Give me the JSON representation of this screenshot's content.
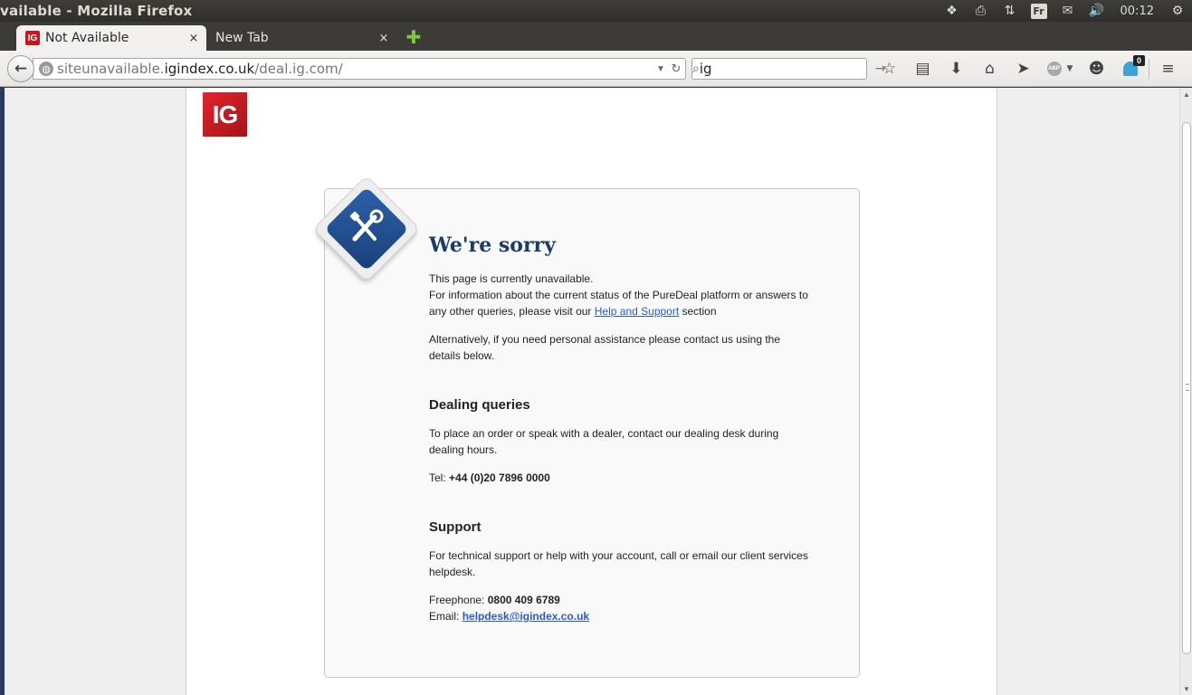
{
  "window": {
    "title": "vailable - Mozilla Firefox"
  },
  "tray": {
    "items": [
      {
        "name": "dropbox-icon",
        "glyph": "❖"
      },
      {
        "name": "printer-icon",
        "glyph": "⎙"
      },
      {
        "name": "network-icon",
        "glyph": "⇅"
      }
    ],
    "keyboard_layout": "Fr",
    "mail_glyph": "✉",
    "volume_glyph": "🔊",
    "clock": "00:12",
    "power_glyph": "⚙"
  },
  "tabs": [
    {
      "label": "Not Available",
      "favicon": "IG",
      "active": true,
      "close": "×"
    },
    {
      "label": "New Tab",
      "active": false,
      "close": "×"
    }
  ],
  "newtab_glyph": "✚",
  "navbar": {
    "back_glyph": "←",
    "url_host": "siteunavailable.",
    "url_domain": "igindex.co.uk",
    "url_path": "/deal.ig.com/",
    "url_dropdown": "▼",
    "reload_glyph": "↻",
    "search_value": "ig",
    "search_glyph": "⌕",
    "search_go": "→",
    "icons": {
      "bookmark": "☆",
      "reading_list": "▤",
      "download": "⬇",
      "home": "⌂",
      "send": "➤",
      "abp_label": "ABP",
      "abp_drop": "▼",
      "chat": "☻",
      "ghost_count": "0",
      "menu": "≡"
    }
  },
  "page": {
    "logo_text": "IG",
    "heading": "We're sorry",
    "intro_line1": "This page is currently unavailable.",
    "intro_line2": "For information about the current status of the PureDeal platform or answers to any other queries, please visit our ",
    "help_link": "Help and Support",
    "intro_tail": " section",
    "alternative": "Alternatively, if you need personal assistance please contact us using the details below.",
    "dealing": {
      "title": "Dealing queries",
      "text": "To place an order or speak with a dealer, contact our dealing desk during dealing hours.",
      "tel_label": "Tel: ",
      "tel": "+44 (0)20 7896 0000"
    },
    "support": {
      "title": "Support",
      "text": "For technical support or help with your account, call or email our client services helpdesk.",
      "freephone_label": "Freephone: ",
      "freephone": "0800 409 6789",
      "email_label": "Email: ",
      "email": "helpdesk@igindex.co.uk"
    }
  },
  "scrollbar": {
    "up": "▲",
    "down": "▼"
  }
}
